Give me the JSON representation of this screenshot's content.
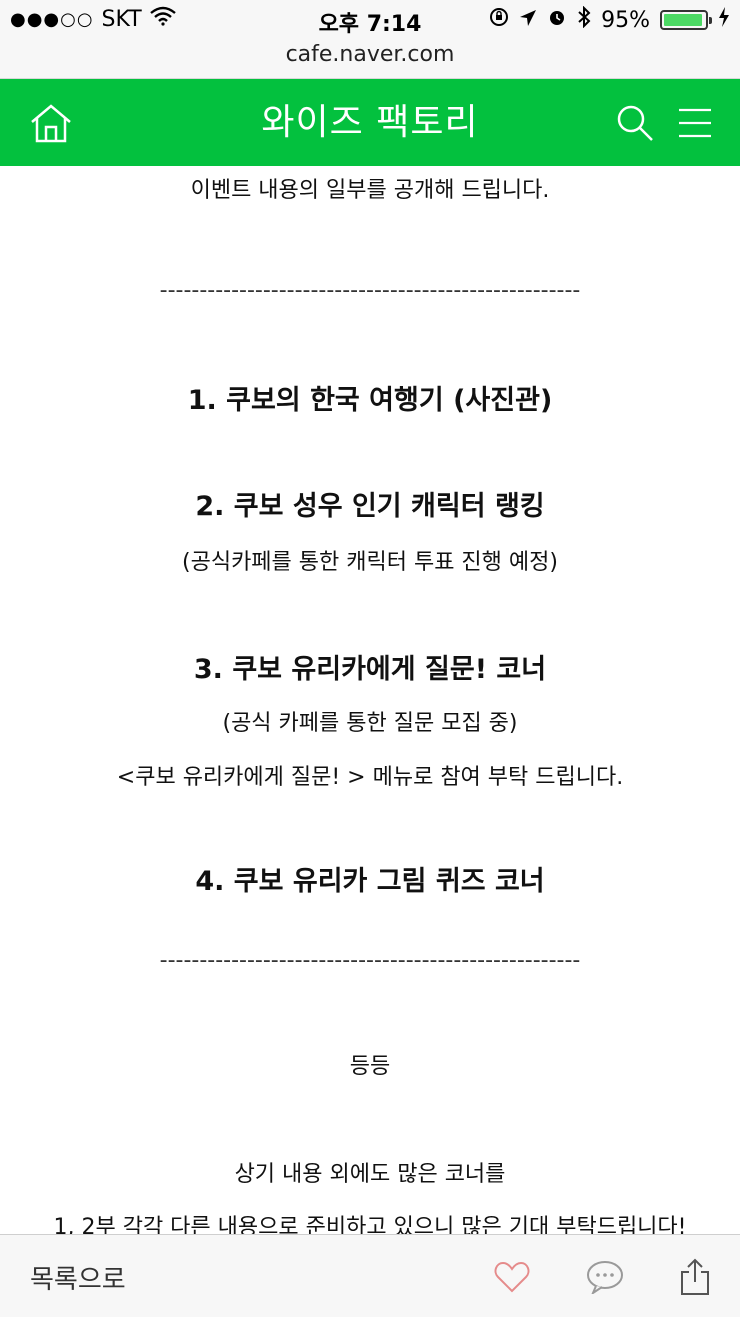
{
  "status_bar": {
    "signal": "●●●○○",
    "carrier": "SKT",
    "time": "오후 7:14",
    "battery_percent": "95%",
    "battery_level": 0.95
  },
  "browser": {
    "url": "cafe.naver.com"
  },
  "header": {
    "title": "와이즈 팩토리",
    "accent_color": "#03c13e"
  },
  "article": {
    "intro": "이벤트 내용의 일부를 공개해 드립니다.",
    "divider": "-----------------------------------------------------",
    "items": [
      {
        "heading": "1. 쿠보의 한국 여행기 (사진관)"
      },
      {
        "heading": "2. 쿠보 성우 인기 캐릭터 랭킹",
        "sub": "(공식카페를 통한 캐릭터 투표 진행 예정)"
      },
      {
        "heading": "3. 쿠보 유리카에게 질문! 코너",
        "sub": "(공식 카페를 통한 질문 모집 중)",
        "sub2": "<쿠보 유리카에게 질문! > 메뉴로 참여 부탁 드립니다."
      },
      {
        "heading": "4. 쿠보 유리카 그림 퀴즈 코너"
      }
    ],
    "etc": "등등",
    "closing_1": "상기 내용 외에도 많은 코너를",
    "closing_2": "1, 2부 각각 다른 내용으로 준비하고 있으니 많은 기대 부탁드립니다!"
  },
  "bottom_bar": {
    "back_label": "목록으로",
    "icons": [
      "heart-icon",
      "comment-icon",
      "share-icon"
    ]
  }
}
